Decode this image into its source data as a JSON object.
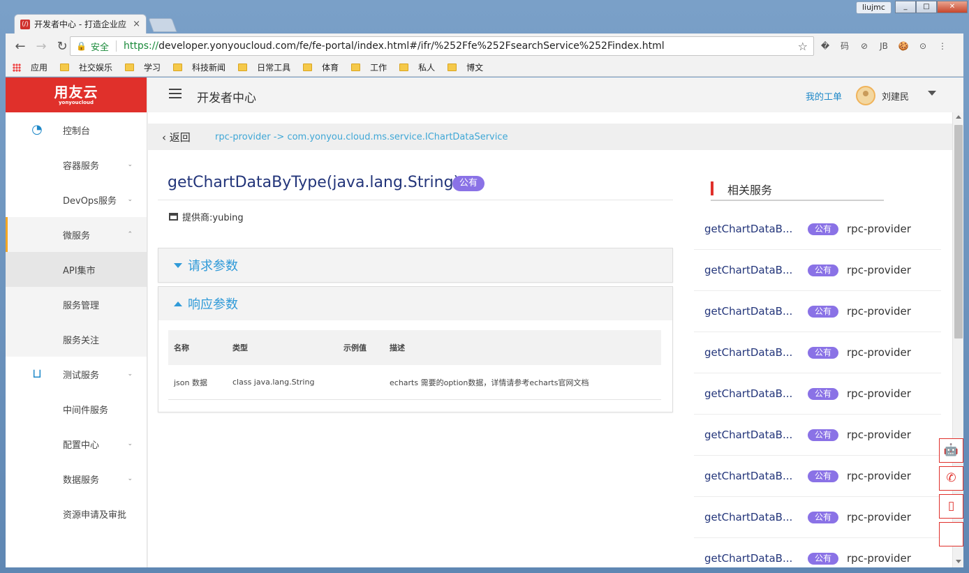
{
  "browser": {
    "tab_title": "开发者中心 - 打造企业应",
    "tab_close": "×",
    "user_chip": "liujmc",
    "win_min": "_",
    "win_max": "□",
    "win_close": "✕",
    "nav_back": "←",
    "nav_forward": "→",
    "nav_reload": "↻",
    "secure_label": "安全",
    "url_proto": "https://",
    "url_rest": "developer.yonyoucloud.com/fe/fe-portal/index.html#/ifr/%252Ffe%252FsearchService%252Findex.html",
    "star": "☆",
    "extensions": [
      "�",
      "码",
      "⊘",
      "JB",
      "🍪",
      "⊙",
      "⋮"
    ],
    "bookmarks": [
      "应用",
      "社交娱乐",
      "学习",
      "科技新闻",
      "日常工具",
      "体育",
      "工作",
      "私人",
      "博文"
    ]
  },
  "logo": {
    "main": "用友云",
    "sub": "yonyoucloud"
  },
  "sidebar": {
    "items": [
      {
        "label": "控制台",
        "chevron": "",
        "icon": "dashboard-icon"
      },
      {
        "label": "容器服务",
        "chevron": "⌄"
      },
      {
        "label": "DevOps服务",
        "chevron": "⌄"
      },
      {
        "label": "微服务",
        "chevron": "⌃"
      },
      {
        "label": "API集市",
        "chevron": ""
      },
      {
        "label": "服务管理",
        "chevron": ""
      },
      {
        "label": "服务关注",
        "chevron": ""
      },
      {
        "label": "测试服务",
        "chevron": "⌄",
        "icon": "bag-icon"
      },
      {
        "label": "中间件服务",
        "chevron": ""
      },
      {
        "label": "配置中心",
        "chevron": "⌄"
      },
      {
        "label": "数据服务",
        "chevron": "⌄"
      },
      {
        "label": "资源申请及审批",
        "chevron": ""
      }
    ]
  },
  "topbar": {
    "title": "开发者中心",
    "my_ticket": "我的工单",
    "username": "刘建民"
  },
  "breadcrumb": {
    "back": "返回",
    "path": "rpc-provider -> com.yonyou.cloud.ms.service.IChartDataService"
  },
  "api": {
    "title": "getChartDataByType(java.lang.String)",
    "badge": "公有",
    "provider": "提供商:yubing"
  },
  "request_panel": {
    "title": "请求参数"
  },
  "response_panel": {
    "title": "响应参数",
    "headers": [
      "名称",
      "类型",
      "示例值",
      "描述"
    ],
    "rows": [
      [
        "json 数据",
        "class java.lang.String",
        "",
        "echarts 需要的option数据，详情请参考echarts官网文档"
      ]
    ]
  },
  "related": {
    "title": "相关服务",
    "items": [
      {
        "name": "getChartDataB...",
        "badge": "公有",
        "provider": "rpc-provider"
      },
      {
        "name": "getChartDataB...",
        "badge": "公有",
        "provider": "rpc-provider"
      },
      {
        "name": "getChartDataB...",
        "badge": "公有",
        "provider": "rpc-provider"
      },
      {
        "name": "getChartDataB...",
        "badge": "公有",
        "provider": "rpc-provider"
      },
      {
        "name": "getChartDataB...",
        "badge": "公有",
        "provider": "rpc-provider"
      },
      {
        "name": "getChartDataB...",
        "badge": "公有",
        "provider": "rpc-provider"
      },
      {
        "name": "getChartDataB...",
        "badge": "公有",
        "provider": "rpc-provider"
      },
      {
        "name": "getChartDataB...",
        "badge": "公有",
        "provider": "rpc-provider"
      },
      {
        "name": "getChartDataB...",
        "badge": "公有",
        "provider": "rpc-provider"
      }
    ]
  },
  "float_buttons": [
    "robot-icon",
    "phone-icon",
    "mobile-icon",
    "blank"
  ],
  "colors": {
    "brand_red": "#e0302b",
    "link_blue": "#1e88c8",
    "badge_purple": "#8a72e6",
    "title_navy": "#23357a"
  }
}
